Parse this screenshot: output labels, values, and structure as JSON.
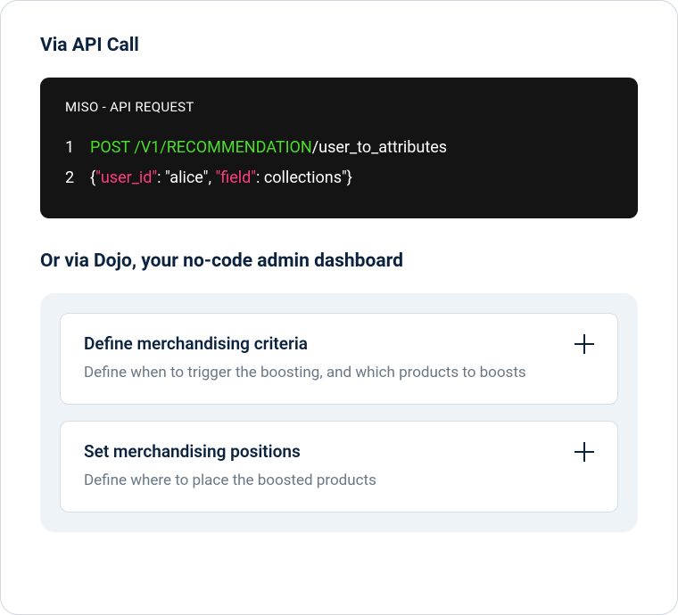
{
  "headings": {
    "api_call": "Via API Call",
    "dojo": "Or via Dojo, your no-code admin dashboard"
  },
  "code_block": {
    "header": "MISO - API REQUEST",
    "lines": [
      {
        "number": "1",
        "parts": [
          {
            "text": "POST /V1/RECOMMENDATION",
            "color": "green"
          },
          {
            "text": "/user_to_attributes",
            "color": "white"
          }
        ]
      },
      {
        "number": "2",
        "parts": [
          {
            "text": "{",
            "color": "white"
          },
          {
            "text": "\"user_id\"",
            "color": "pink"
          },
          {
            "text": ": \"alice\", ",
            "color": "white"
          },
          {
            "text": "\"field\"",
            "color": "pink"
          },
          {
            "text": ": collections\"}",
            "color": "white"
          }
        ]
      }
    ]
  },
  "accordion": [
    {
      "title": "Define merchandising criteria",
      "description": "Define when to trigger the boosting, and which products to boosts"
    },
    {
      "title": "Set merchandising positions",
      "description": "Define where to place the boosted products"
    }
  ]
}
